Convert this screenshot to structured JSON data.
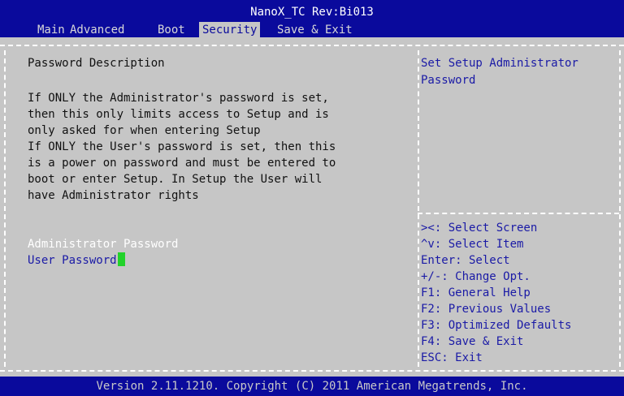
{
  "header": {
    "title": "NanoX_TC Rev:Bi013",
    "tabs": [
      {
        "label": "Main",
        "active": false
      },
      {
        "label": "Advanced",
        "active": false
      },
      {
        "label": "Boot",
        "active": false
      },
      {
        "label": "Security",
        "active": true
      },
      {
        "label": "Save & Exit",
        "active": false
      }
    ]
  },
  "main": {
    "section_title": "Password Description",
    "description_lines": [
      "If ONLY the Administrator's password is set,",
      "then this only limits access to Setup and is",
      "only asked for when entering Setup",
      "If ONLY the User's password is set, then this",
      "is a power on password and must be entered to",
      "boot or enter Setup. In Setup the User will",
      "have Administrator rights"
    ],
    "items": [
      {
        "label": "Administrator Password"
      },
      {
        "label": "User Password"
      }
    ]
  },
  "help": {
    "description_lines": [
      "Set Setup Administrator",
      "Password"
    ],
    "keys": [
      "><: Select Screen",
      "^v: Select Item",
      "Enter: Select",
      "+/-: Change Opt.",
      "F1: General Help",
      "F2: Previous Values",
      "F3: Optimized Defaults",
      "F4: Save & Exit",
      "ESC: Exit"
    ]
  },
  "footer": {
    "text": "Version 2.11.1210. Copyright (C) 2011 American Megatrends, Inc."
  },
  "colors": {
    "header_bg": "#0a0a9c",
    "body_bg": "#c6c6c6",
    "highlight_text": "#ffffff",
    "selectable_text": "#1a1aa6",
    "cursor": "#22d22a"
  }
}
